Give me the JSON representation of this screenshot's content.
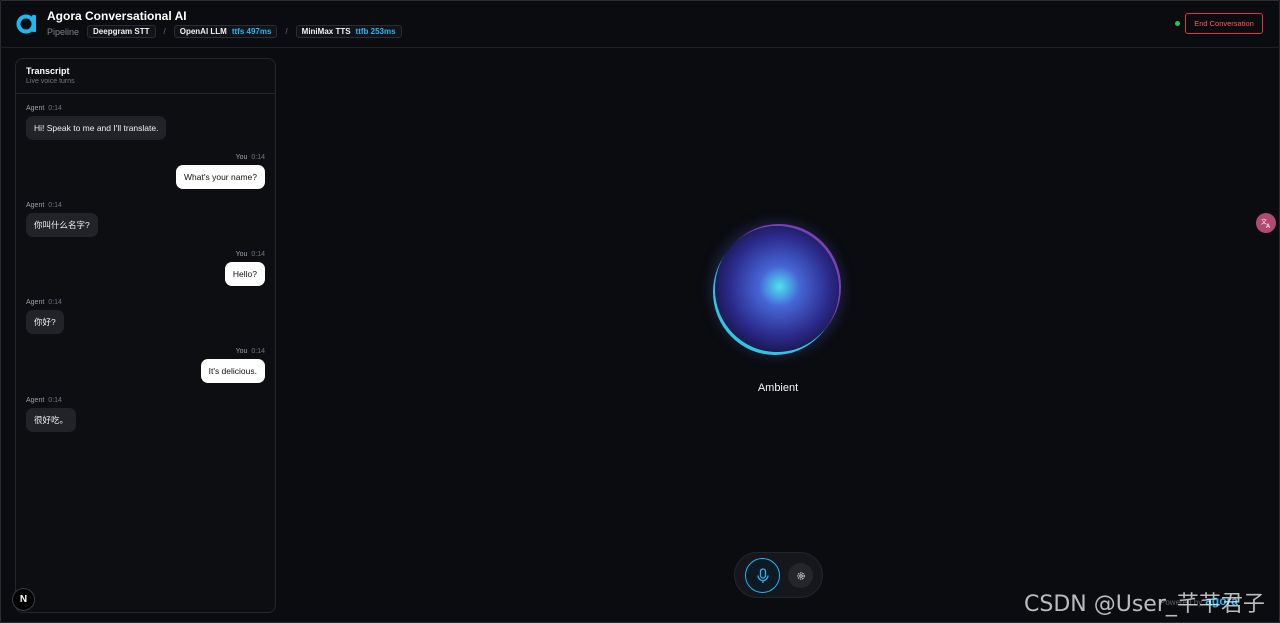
{
  "header": {
    "title": "Agora Conversational AI",
    "pipeline_label": "Pipeline",
    "stt": {
      "name": "Deepgram STT"
    },
    "llm": {
      "name": "OpenAI LLM",
      "ttfs": "ttfs 497ms"
    },
    "tts": {
      "name": "MiniMax TTS",
      "ttfb": "ttfb 253ms"
    },
    "separator": "/",
    "end_button": "End Conversation",
    "status_color": "#22c55e"
  },
  "transcript": {
    "title": "Transcript",
    "subtitle": "Live voice turns",
    "messages": [
      {
        "speaker": "Agent",
        "time": "0:14",
        "text": "Hi! Speak to me and I'll translate."
      },
      {
        "speaker": "You",
        "time": "0:14",
        "text": "What's your name?"
      },
      {
        "speaker": "Agent",
        "time": "0:14",
        "text": "你叫什么名字?"
      },
      {
        "speaker": "You",
        "time": "0:14",
        "text": "Hello?"
      },
      {
        "speaker": "Agent",
        "time": "0:14",
        "text": "你好?"
      },
      {
        "speaker": "You",
        "time": "0:14",
        "text": "It's delicious."
      },
      {
        "speaker": "Agent",
        "time": "0:14",
        "text": "很好吃。"
      }
    ]
  },
  "orb": {
    "state_label": "Ambient"
  },
  "controls": {
    "mic_icon": "microphone-icon",
    "settings_icon": "gear-icon"
  },
  "badge": {
    "letter": "N"
  },
  "footer": {
    "powered_text": "Powered by",
    "brand": "agora"
  },
  "watermark": "CSDN @User_芊芊君子",
  "colors": {
    "accent": "#29b6f6",
    "danger": "#ff5a5f",
    "background": "#0b0c10"
  }
}
